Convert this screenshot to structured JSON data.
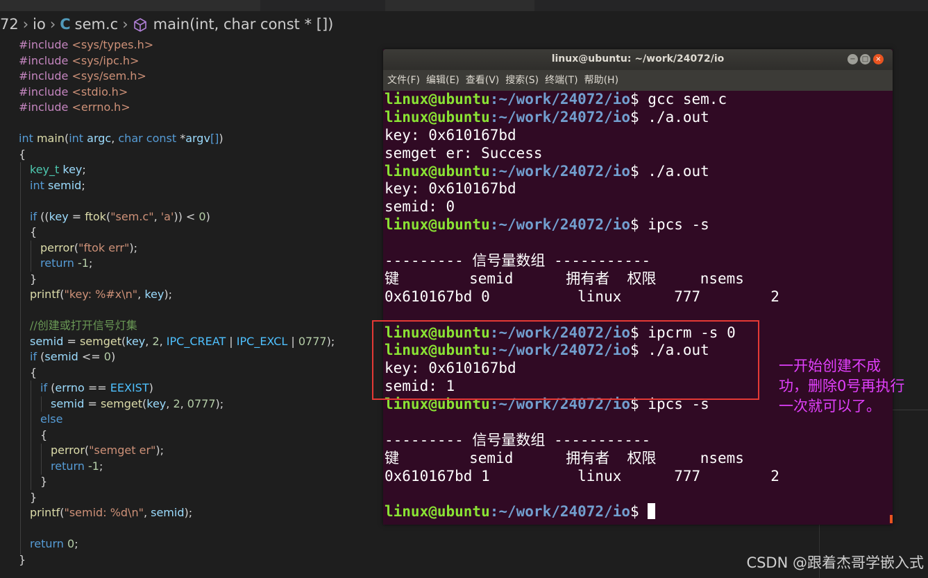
{
  "breadcrumb": {
    "folder_partial": "72",
    "folder": "io",
    "file_icon": "C",
    "file": "sem.c",
    "symbol": "main(int, char const * [])"
  },
  "code": [
    [
      [
        "inc",
        "#include "
      ],
      [
        "str",
        "<sys/types.h>"
      ]
    ],
    [
      [
        "inc",
        "#include "
      ],
      [
        "str",
        "<sys/ipc.h>"
      ]
    ],
    [
      [
        "inc",
        "#include "
      ],
      [
        "str",
        "<sys/sem.h>"
      ]
    ],
    [
      [
        "inc",
        "#include "
      ],
      [
        "str",
        "<stdio.h>"
      ]
    ],
    [
      [
        "inc",
        "#include "
      ],
      [
        "str",
        "<errno.h>"
      ]
    ],
    [],
    [
      [
        "kw",
        "int "
      ],
      [
        "fn",
        "main"
      ],
      [
        "p",
        "("
      ],
      [
        "kw",
        "int "
      ],
      [
        "var",
        "argc"
      ],
      [
        "p",
        ", "
      ],
      [
        "kw",
        "char const "
      ],
      [
        "p",
        "*"
      ],
      [
        "var",
        "argv"
      ],
      [
        "kw",
        "[]"
      ],
      [
        "p",
        ")"
      ]
    ],
    [
      [
        "p",
        "{"
      ]
    ],
    [
      [
        "ind1",
        ""
      ],
      [
        "ty",
        "key_t "
      ],
      [
        "var",
        "key"
      ],
      [
        "p",
        ";"
      ]
    ],
    [
      [
        "ind1",
        ""
      ],
      [
        "kw",
        "int "
      ],
      [
        "var",
        "semid"
      ],
      [
        "p",
        ";"
      ]
    ],
    [],
    [
      [
        "ind1",
        ""
      ],
      [
        "kw",
        "if "
      ],
      [
        "p",
        "(("
      ],
      [
        "var",
        "key"
      ],
      [
        "p",
        " = "
      ],
      [
        "fn",
        "ftok"
      ],
      [
        "p",
        "("
      ],
      [
        "str",
        "\"sem.c\""
      ],
      [
        "p",
        ", "
      ],
      [
        "str",
        "'a'"
      ],
      [
        "p",
        ")) < "
      ],
      [
        "num",
        "0"
      ],
      [
        "p",
        ")"
      ]
    ],
    [
      [
        "ind1",
        ""
      ],
      [
        "p",
        "{"
      ]
    ],
    [
      [
        "ind2",
        ""
      ],
      [
        "fn",
        "perror"
      ],
      [
        "p",
        "("
      ],
      [
        "str",
        "\"ftok err\""
      ],
      [
        "p",
        ");"
      ]
    ],
    [
      [
        "ind2",
        ""
      ],
      [
        "kw",
        "return "
      ],
      [
        "num",
        "-1"
      ],
      [
        "p",
        ";"
      ]
    ],
    [
      [
        "ind1",
        ""
      ],
      [
        "p",
        "}"
      ]
    ],
    [
      [
        "ind1",
        ""
      ],
      [
        "fn",
        "printf"
      ],
      [
        "p",
        "("
      ],
      [
        "str",
        "\"key: %#x\\n\""
      ],
      [
        "p",
        ", "
      ],
      [
        "var",
        "key"
      ],
      [
        "p",
        ");"
      ]
    ],
    [],
    [
      [
        "ind1",
        ""
      ],
      [
        "cmt",
        "//创建或打开信号灯集"
      ]
    ],
    [
      [
        "ind1",
        ""
      ],
      [
        "var",
        "semid"
      ],
      [
        "p",
        " = "
      ],
      [
        "fn",
        "semget"
      ],
      [
        "p",
        "("
      ],
      [
        "var",
        "key"
      ],
      [
        "p",
        ", "
      ],
      [
        "num",
        "2"
      ],
      [
        "p",
        ", "
      ],
      [
        "mac",
        "IPC_CREAT"
      ],
      [
        "p",
        " | "
      ],
      [
        "mac",
        "IPC_EXCL"
      ],
      [
        "p",
        " | "
      ],
      [
        "num",
        "0777"
      ],
      [
        "p",
        ");"
      ]
    ],
    [
      [
        "ind1",
        ""
      ],
      [
        "kw",
        "if "
      ],
      [
        "p",
        "("
      ],
      [
        "var",
        "semid"
      ],
      [
        "p",
        " <= "
      ],
      [
        "num",
        "0"
      ],
      [
        "p",
        ")"
      ]
    ],
    [
      [
        "ind1",
        ""
      ],
      [
        "p",
        "{"
      ]
    ],
    [
      [
        "ind2",
        ""
      ],
      [
        "kw",
        "if "
      ],
      [
        "p",
        "("
      ],
      [
        "var",
        "errno"
      ],
      [
        "p",
        " == "
      ],
      [
        "mac",
        "EEXIST"
      ],
      [
        "p",
        ")"
      ]
    ],
    [
      [
        "ind3",
        ""
      ],
      [
        "var",
        "semid"
      ],
      [
        "p",
        " = "
      ],
      [
        "fn",
        "semget"
      ],
      [
        "p",
        "("
      ],
      [
        "var",
        "key"
      ],
      [
        "p",
        ", "
      ],
      [
        "num",
        "2"
      ],
      [
        "p",
        ", "
      ],
      [
        "num",
        "0777"
      ],
      [
        "p",
        ");"
      ]
    ],
    [
      [
        "ind2",
        ""
      ],
      [
        "kw",
        "else"
      ]
    ],
    [
      [
        "ind2",
        ""
      ],
      [
        "p",
        "{"
      ]
    ],
    [
      [
        "ind3",
        ""
      ],
      [
        "fn",
        "perror"
      ],
      [
        "p",
        "("
      ],
      [
        "str",
        "\"semget er\""
      ],
      [
        "p",
        ");"
      ]
    ],
    [
      [
        "ind3",
        ""
      ],
      [
        "kw",
        "return "
      ],
      [
        "num",
        "-1"
      ],
      [
        "p",
        ";"
      ]
    ],
    [
      [
        "ind2",
        ""
      ],
      [
        "p",
        "}"
      ]
    ],
    [
      [
        "ind1",
        ""
      ],
      [
        "p",
        "}"
      ]
    ],
    [
      [
        "ind1",
        ""
      ],
      [
        "fn",
        "printf"
      ],
      [
        "p",
        "("
      ],
      [
        "str",
        "\"semid: %d\\n\""
      ],
      [
        "p",
        ", "
      ],
      [
        "var",
        "semid"
      ],
      [
        "p",
        ");"
      ]
    ],
    [],
    [
      [
        "ind1",
        ""
      ],
      [
        "kw",
        "return "
      ],
      [
        "num",
        "0"
      ],
      [
        "p",
        ";"
      ]
    ],
    [
      [
        "p",
        "}"
      ]
    ]
  ],
  "terminal": {
    "title": "linux@ubuntu: ~/work/24072/io",
    "menu": [
      "文件(F)",
      "编辑(E)",
      "查看(V)",
      "搜索(S)",
      "终端(T)",
      "帮助(H)"
    ],
    "prompt_user": "linux@ubuntu",
    "prompt_path": ":~/work/24072/io",
    "lines": [
      {
        "type": "cmd",
        "text": "$ gcc sem.c"
      },
      {
        "type": "cmd",
        "text": "$ ./a.out"
      },
      {
        "type": "out",
        "text": "key: 0x610167bd"
      },
      {
        "type": "out",
        "text": "semget er: Success"
      },
      {
        "type": "cmd",
        "text": "$ ./a.out"
      },
      {
        "type": "out",
        "text": "key: 0x610167bd"
      },
      {
        "type": "out",
        "text": "semid: 0"
      },
      {
        "type": "cmd",
        "text": "$ ipcs -s"
      },
      {
        "type": "out",
        "text": ""
      },
      {
        "type": "out",
        "text": "--------- 信号量数组 -----------"
      },
      {
        "type": "out",
        "text": "键        semid      拥有者  权限     nsems"
      },
      {
        "type": "out",
        "text": "0x610167bd 0          linux      777        2"
      },
      {
        "type": "out",
        "text": ""
      },
      {
        "type": "cmd",
        "text": "$ ipcrm -s 0"
      },
      {
        "type": "cmd",
        "text": "$ ./a.out"
      },
      {
        "type": "out",
        "text": "key: 0x610167bd"
      },
      {
        "type": "out",
        "text": "semid: 1"
      },
      {
        "type": "cmd",
        "text": "$ ipcs -s"
      },
      {
        "type": "out",
        "text": ""
      },
      {
        "type": "out",
        "text": "--------- 信号量数组 -----------"
      },
      {
        "type": "out",
        "text": "键        semid      拥有者  权限     nsems"
      },
      {
        "type": "out",
        "text": "0x610167bd 1          linux      777        2"
      },
      {
        "type": "out",
        "text": ""
      },
      {
        "type": "cmd",
        "text": "$ ",
        "cursor": true
      }
    ]
  },
  "annotation": [
    "一开始创建不成",
    "功，删除0号再执行",
    "一次就可以了。"
  ],
  "watermark": "CSDN @跟着杰哥学嵌入式",
  "colors": {
    "terminal_bg": "#300a24",
    "prompt_user": "#8ae234",
    "prompt_path": "#729fcf",
    "highlight": "#e53935",
    "annotation": "#e040fb"
  }
}
